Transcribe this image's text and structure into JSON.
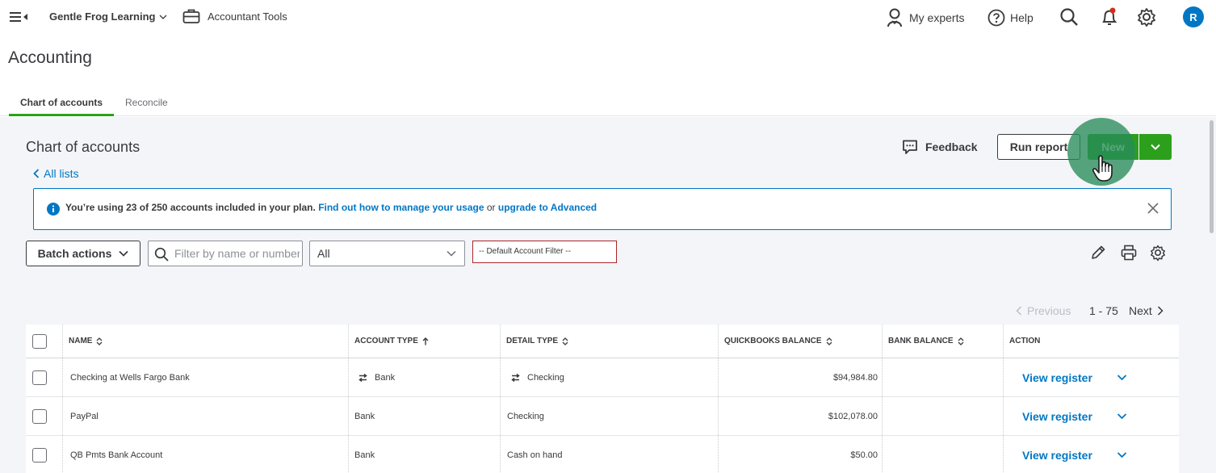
{
  "topbar": {
    "company": "Gentle Frog Learning",
    "accountant_tools": "Accountant Tools",
    "my_experts": "My experts",
    "help": "Help",
    "avatar_initial": "R"
  },
  "page_title": "Accounting",
  "tabs": [
    {
      "label": "Chart of accounts",
      "active": true
    },
    {
      "label": "Reconcile",
      "active": false
    }
  ],
  "section": {
    "title": "Chart of accounts",
    "back_link": "All lists",
    "feedback": "Feedback",
    "run_report": "Run report",
    "new_button": "New"
  },
  "banner": {
    "text": "You’re using 23 of 250 accounts included in your plan.",
    "link1": "Find out how to manage your usage",
    "or": "or",
    "link2": "upgrade to Advanced"
  },
  "filters": {
    "batch_actions": "Batch actions",
    "search_placeholder": "Filter by name or number",
    "type_value": "All",
    "default_filter": "-- Default Account Filter --"
  },
  "pagination": {
    "previous": "Previous",
    "range": "1 - 75",
    "next": "Next"
  },
  "table": {
    "columns": [
      "NAME",
      "ACCOUNT TYPE",
      "DETAIL TYPE",
      "QUICKBOOKS BALANCE",
      "BANK BALANCE",
      "ACTION"
    ],
    "rows": [
      {
        "name": "Checking at Wells Fargo Bank",
        "account_type": "Bank",
        "detail_type": "Checking",
        "qb_balance": "$94,984.80",
        "bank_balance": "",
        "action": "View register",
        "linked": true
      },
      {
        "name": "PayPal",
        "account_type": "Bank",
        "detail_type": "Checking",
        "qb_balance": "$102,078.00",
        "bank_balance": "",
        "action": "View register",
        "linked": false
      },
      {
        "name": "QB Pmts Bank Account",
        "account_type": "Bank",
        "detail_type": "Cash on hand",
        "qb_balance": "$50.00",
        "bank_balance": "",
        "action": "View register",
        "linked": false
      }
    ]
  },
  "colors": {
    "brand_green": "#2ca01c",
    "link_blue": "#0077c5",
    "text": "#393a3d",
    "panel_bg": "#f4f5f8"
  }
}
